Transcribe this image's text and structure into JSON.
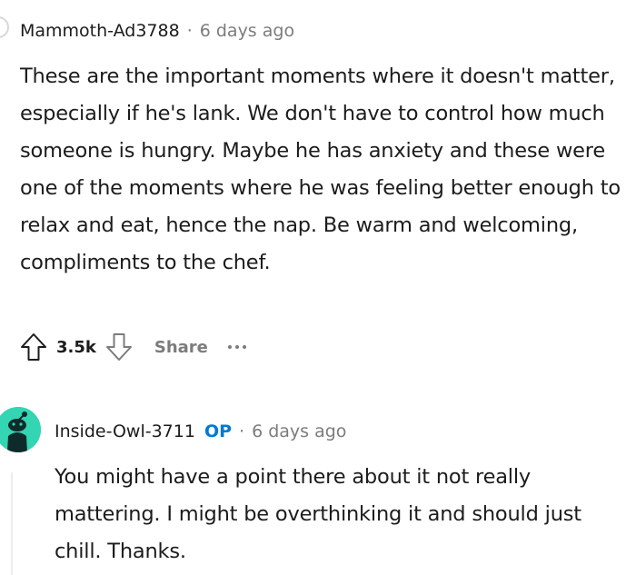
{
  "comments": [
    {
      "author": "Mammoth-Ad3788",
      "separator": "·",
      "time": "6 days ago",
      "body": "These are the important moments where it doesn't matter, especially if he's lank. We don't have to control how much someone is hungry. Maybe he has anxiety and these were one of the moments where he was feeling better enough to relax and eat, hence the nap. Be warm and welcoming, compliments to the chef.",
      "score": "3.5k",
      "share_label": "Share",
      "icons": {
        "upvote": "arrow-up-icon",
        "downvote": "arrow-down-icon",
        "more": "ellipsis-icon"
      }
    },
    {
      "author": "Inside-Owl-3711",
      "badge": "OP",
      "separator": "·",
      "time": "6 days ago",
      "body": "You might have a point there about it not really mattering. I might be overthinking it and should just chill. Thanks.",
      "avatar_color": "#33d5b3",
      "icons": {
        "avatar": "snoo-avatar-icon"
      }
    }
  ],
  "colors": {
    "text": "#1c1c1c",
    "meta": "#7c7c7c",
    "op_badge": "#0079d3",
    "thread_line": "#ededed"
  }
}
